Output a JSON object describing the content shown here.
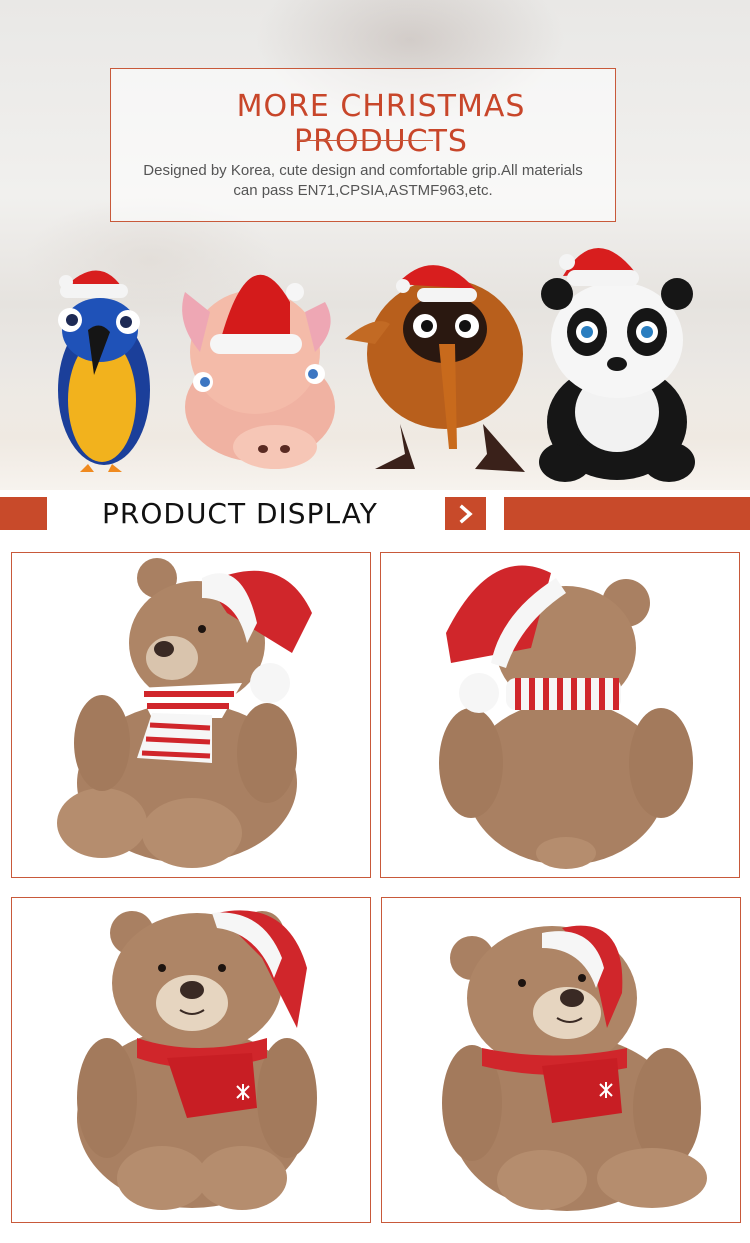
{
  "hero": {
    "title": "MORE CHRISTMAS PRODUCTS",
    "description": "Designed by Korea, cute design and comfortable grip.All materials can pass EN71,CPSIA,ASTMF963,etc."
  },
  "section": {
    "title": "PRODUCT DISPLAY",
    "arrow_icon": "chevron-right-icon"
  },
  "colors": {
    "accent": "#c84a2a",
    "title_red": "#c8462a",
    "border": "#c8593a"
  },
  "products": [
    {
      "id": "bear-front-striped-scarf",
      "icon": "teddy-bear-front"
    },
    {
      "id": "bear-back-striped-scarf",
      "icon": "teddy-bear-back"
    },
    {
      "id": "bear-front-red-scarf",
      "icon": "teddy-bear-front"
    },
    {
      "id": "bear-three-quarter-red-scarf",
      "icon": "teddy-bear-side"
    }
  ]
}
